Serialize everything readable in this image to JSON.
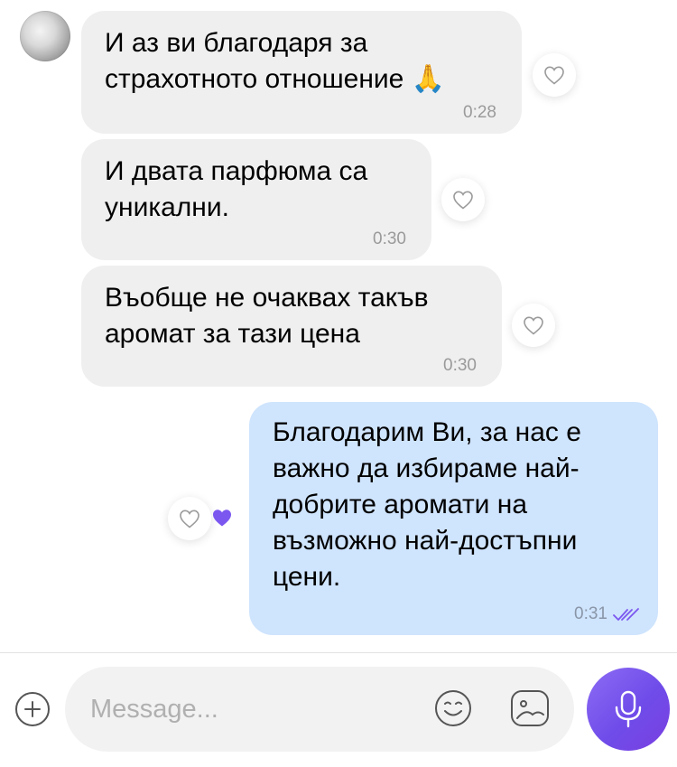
{
  "colors": {
    "incoming_bubble": "#efefef",
    "outgoing_bubble": "#cfe4fd",
    "accent": "#7b57f0",
    "timestamp": "#9a9a9a"
  },
  "messages": [
    {
      "direction": "incoming",
      "text": "И аз ви благодаря за\nстрахотното отношение 🙏",
      "time": "0:28",
      "reaction": "heart-outline"
    },
    {
      "direction": "incoming",
      "text": "И двата парфюма са\nуникални.",
      "time": "0:30",
      "reaction": "heart-outline"
    },
    {
      "direction": "incoming",
      "text": "Въобще не очаквах такъв\nаромат за тази цена",
      "time": "0:30",
      "reaction": "heart-outline"
    },
    {
      "direction": "outgoing",
      "text": "Благодарим Ви, за нас е\nважно да избираме най-\nдобрите аромати на\nвъзможно най-достъпни\nцени.",
      "time": "0:31",
      "status": "read",
      "reaction": "purple-heart"
    }
  ],
  "composer": {
    "placeholder": "Message...",
    "add_icon": "plus-circle-icon",
    "emoji_icon": "smiley-icon",
    "sticker_icon": "sticker-icon",
    "send_icon": "microphone-icon"
  }
}
